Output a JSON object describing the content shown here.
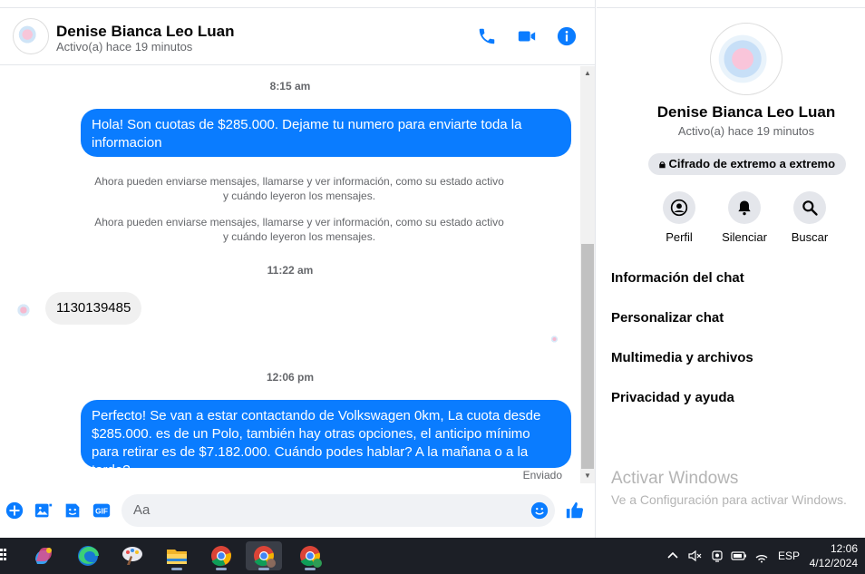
{
  "header": {
    "name": "Denise Bianca Leo Luan",
    "status": "Activo(a) hace 19 minutos"
  },
  "messages": {
    "ts1": "8:15 am",
    "out1": "Hola! Son cuotas de $285.000. Dejame tu numero para enviarte toda la informacion",
    "sys1": "Ahora pueden enviarse mensajes, llamarse y ver información, como su estado activo y cuándo leyeron los mensajes.",
    "sys2": "Ahora pueden enviarse mensajes, llamarse y ver información, como su estado activo y cuándo leyeron los mensajes.",
    "ts2": "11:22 am",
    "in1": "1130139485",
    "ts3": "12:06 pm",
    "out2": "Perfecto!  Se van a estar contactando de Volkswagen 0km, La cuota desde $285.000. es de un Polo, también hay otras opciones, el anticipo mínimo para retirar es de $7.182.000. Cuándo podes hablar? A la mañana o a la tarde?",
    "sent_label": "Enviado"
  },
  "composer": {
    "placeholder": "Aa"
  },
  "info": {
    "name": "Denise Bianca Leo Luan",
    "status": "Activo(a) hace 19 minutos",
    "e2e": "Cifrado de extremo a extremo",
    "actions": [
      "Perfil",
      "Silenciar",
      "Buscar"
    ],
    "menu": [
      "Información del chat",
      "Personalizar chat",
      "Multimedia y archivos",
      "Privacidad y ayuda"
    ]
  },
  "watermark": {
    "line1": "Activar Windows",
    "line2": "Ve a Configuración para activar Windows."
  },
  "taskbar": {
    "lang": "ESP",
    "time": "12:06",
    "date": "4/12/2024"
  },
  "colors": {
    "accent": "#0a7cff",
    "taskbar": "#1c1f26"
  }
}
